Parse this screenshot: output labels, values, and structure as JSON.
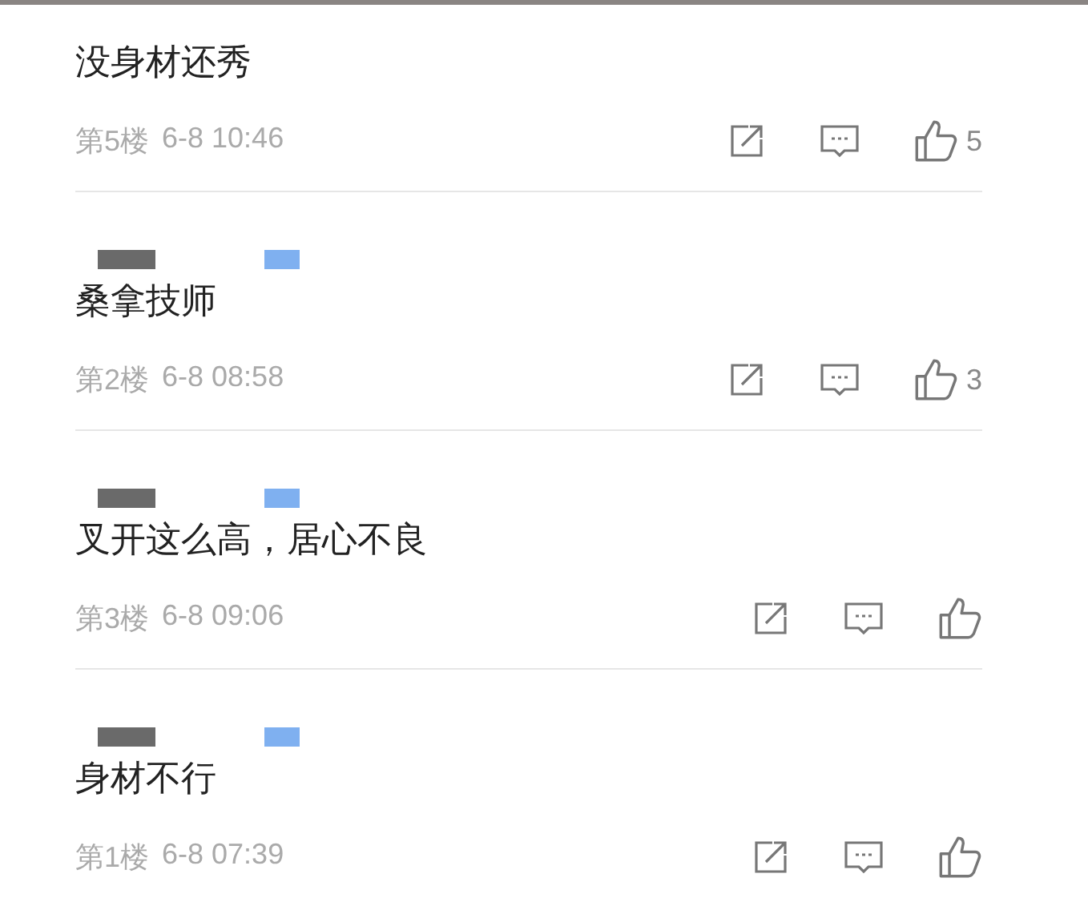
{
  "comments": [
    {
      "name_redacted": false,
      "text": "没身材还秀",
      "floor": "第5楼",
      "time": "6-8 10:46",
      "likes": "5"
    },
    {
      "name_redacted": true,
      "text": "桑拿技师",
      "floor": "第2楼",
      "time": "6-8 08:58",
      "likes": "3"
    },
    {
      "name_redacted": true,
      "text": "叉开这么高，居心不良",
      "floor": "第3楼",
      "time": "6-8 09:06"
    },
    {
      "name_redacted": true,
      "text": "身材不行",
      "floor": "第1楼",
      "time": "6-8 07:39"
    }
  ]
}
